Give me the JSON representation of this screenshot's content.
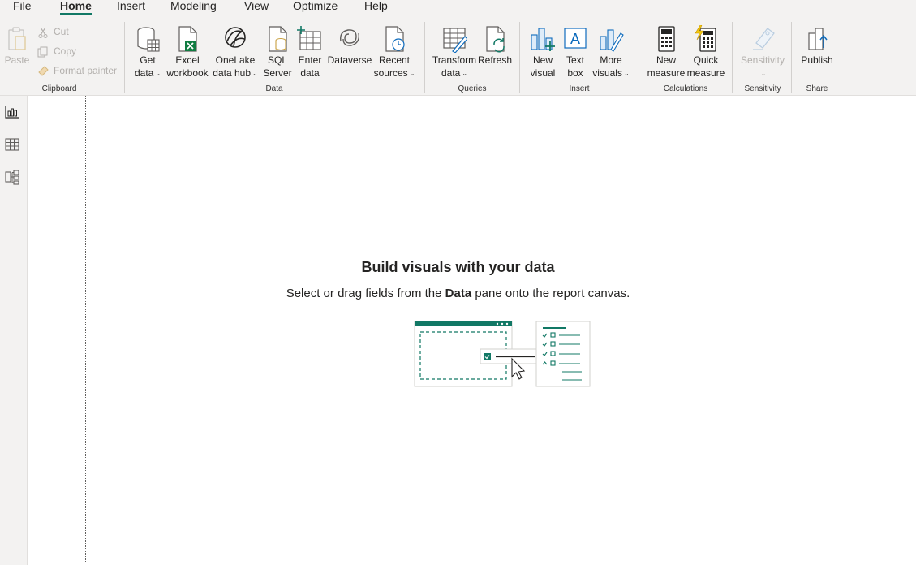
{
  "menu": {
    "items": [
      "File",
      "Home",
      "Insert",
      "Modeling",
      "View",
      "Optimize",
      "Help"
    ],
    "active": "Home"
  },
  "ribbon": {
    "clipboard": {
      "paste": "Paste",
      "cut": "Cut",
      "copy": "Copy",
      "format_painter": "Format painter",
      "label": "Clipboard"
    },
    "data": {
      "get_data": [
        "Get",
        "data"
      ],
      "excel": [
        "Excel",
        "workbook"
      ],
      "onelake": [
        "OneLake",
        "data hub"
      ],
      "sql": [
        "SQL",
        "Server"
      ],
      "enter": [
        "Enter",
        "data"
      ],
      "dataverse": "Dataverse",
      "recent": [
        "Recent",
        "sources"
      ],
      "label": "Data"
    },
    "queries": {
      "transform": [
        "Transform",
        "data"
      ],
      "refresh": "Refresh",
      "label": "Queries"
    },
    "insert": {
      "new_visual": [
        "New",
        "visual"
      ],
      "text_box": [
        "Text",
        "box"
      ],
      "more_visuals": [
        "More",
        "visuals"
      ],
      "label": "Insert"
    },
    "calculations": {
      "new_measure": [
        "New",
        "measure"
      ],
      "quick_measure": [
        "Quick",
        "measure"
      ],
      "label": "Calculations"
    },
    "sensitivity": {
      "button": "Sensitivity",
      "label": "Sensitivity"
    },
    "share": {
      "publish": "Publish",
      "label": "Share"
    }
  },
  "left_nav": {
    "icons": [
      "report-view-icon",
      "table-view-icon",
      "model-view-icon"
    ]
  },
  "canvas": {
    "title": "Build visuals with your data",
    "sub_before": "Select or drag fields from the ",
    "sub_bold": "Data",
    "sub_after": " pane onto the report canvas."
  },
  "colors": {
    "accent": "#117865",
    "background": "#f3f2f1",
    "canvas": "#ffffff"
  }
}
